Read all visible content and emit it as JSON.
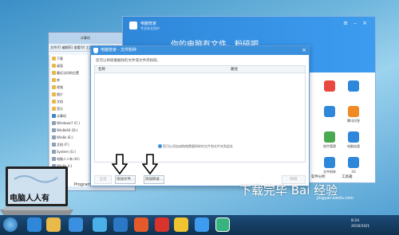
{
  "explorer": {
    "titlebar": "计算机",
    "address": "计算机",
    "toolbar": "文件(F)  编辑(E)  查看(V)  工具(T)  帮助(H)",
    "toolbar2": "组织 ▾  打开",
    "nav_items": [
      {
        "label": "下载",
        "icon": "folder"
      },
      {
        "label": "桌面",
        "icon": "folder"
      },
      {
        "label": "最近访问的位置",
        "icon": "folder"
      },
      {
        "label": "库",
        "icon": "folder"
      },
      {
        "label": "视频",
        "icon": "folder"
      },
      {
        "label": "图片",
        "icon": "folder"
      },
      {
        "label": "文档",
        "icon": "folder"
      },
      {
        "label": "音乐",
        "icon": "folder"
      },
      {
        "label": "计算机",
        "icon": "computer"
      },
      {
        "label": "Windows7 (C:)",
        "icon": "drive"
      },
      {
        "label": "Win8x64 (D:)",
        "icon": "drive"
      },
      {
        "label": "Win8x (E:)",
        "icon": "drive"
      },
      {
        "label": "文档 (F:)",
        "icon": "drive"
      },
      {
        "label": "System (G:)",
        "icon": "drive"
      },
      {
        "label": "电脑人人有 (H:)",
        "icon": "drive"
      },
      {
        "label": "Win8x (I:)",
        "icon": "drive"
      }
    ],
    "status": "Program"
  },
  "manager": {
    "title": "电脑管家",
    "subtitle": "专业安全防护",
    "slogan": "你的电脑有文件，粉碎吧",
    "tools": [
      {
        "label": "",
        "color": "#e9483f"
      },
      {
        "label": "",
        "color": "#2f87d9"
      },
      {
        "label": "",
        "color": "#2f87d9"
      },
      {
        "label": "腾讯问答",
        "color": "#f08a24"
      },
      {
        "label": "浏览器保护",
        "color": "#2f87d9"
      },
      {
        "label": "软件管理",
        "color": "#4aa84f"
      },
      {
        "label": "电脑加速",
        "color": "#2f87d9"
      },
      {
        "label": "手游助手",
        "color": "#f08a24"
      },
      {
        "label": "文件粉碎",
        "color": "#2f87d9"
      },
      {
        "label": "3G",
        "color": "#2f87d9"
      }
    ],
    "bottom_items": [
      "软件分析",
      "工具箱"
    ]
  },
  "dialog": {
    "title": "电脑管家 - 文件粉碎",
    "description": "您可以将很难删除的文件或文件夹粉碎。",
    "col_name": "名称",
    "col_path": "路径",
    "empty_hint": "您可以添加或拖拽需要粉碎的文件和文件夹到此处",
    "delete_label": "全选",
    "add_file_label": "添加文件...",
    "add_folder_label": "添加目录...",
    "shred_label": "粉碎"
  },
  "taskbar": {
    "time": "8:24",
    "date": "2016/10/1"
  },
  "watermark": {
    "text": "下载完毕 Bai 经验",
    "url": "jingyan.baidu.com"
  },
  "logo": {
    "text": "电脑人人有"
  }
}
